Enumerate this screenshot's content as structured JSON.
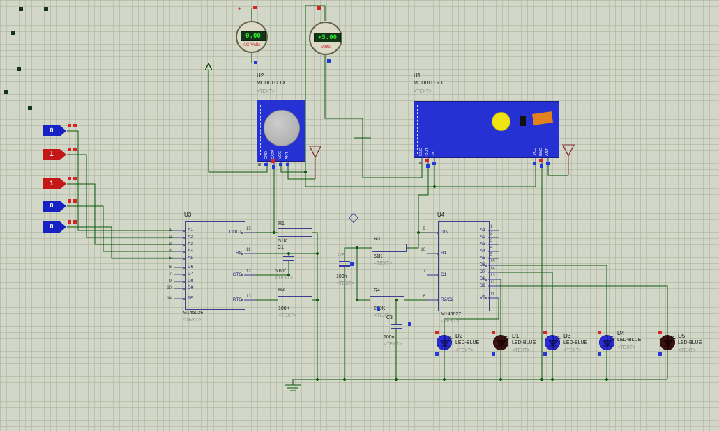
{
  "meters": {
    "ac": {
      "reading": "0.00",
      "label": "AC Volts",
      "plus": "+",
      "minus": "-"
    },
    "dc": {
      "reading": "+5.00",
      "label": "Volts"
    }
  },
  "modules": {
    "tx": {
      "ref": "U2",
      "name": "MODULO TX",
      "text": "<TEXT>",
      "pins": [
        "GND",
        "DATA",
        "VCC",
        "ANT"
      ]
    },
    "rx": {
      "ref": "U1",
      "name": "MODULO RX",
      "text": "<TEXT>",
      "left_pins": [
        "GND",
        "OUT",
        "VCC"
      ],
      "right_pins": [
        "VCC",
        "GND",
        "ANT"
      ]
    }
  },
  "logic_inputs": [
    {
      "value": "0",
      "state": "low"
    },
    {
      "value": "1",
      "state": "high"
    },
    {
      "value": "1",
      "state": "high"
    },
    {
      "value": "0",
      "state": "low"
    },
    {
      "value": "0",
      "state": "low"
    }
  ],
  "u3": {
    "ref": "U3",
    "part": "M145026",
    "text": "<TEXT>",
    "left_pins": [
      {
        "num": "1",
        "label": "A1"
      },
      {
        "num": "2",
        "label": "A2"
      },
      {
        "num": "3",
        "label": "A3"
      },
      {
        "num": "4",
        "label": "A4"
      },
      {
        "num": "5",
        "label": "A5"
      },
      {
        "num": "6",
        "label": "D6"
      },
      {
        "num": "7",
        "label": "D7"
      },
      {
        "num": "9",
        "label": "D8"
      },
      {
        "num": "10",
        "label": "D9"
      },
      {
        "num": "14",
        "label": "TE"
      }
    ],
    "right_pins": [
      {
        "num": "15",
        "label": "DOUT"
      },
      {
        "num": "11",
        "label": "RS"
      },
      {
        "num": "12",
        "label": "CTC"
      },
      {
        "num": "13",
        "label": "RTC"
      }
    ]
  },
  "u4": {
    "ref": "U4",
    "part": "M145027",
    "text": "<TEXT>",
    "left_pins": [
      {
        "num": "9",
        "label": "DIN"
      },
      {
        "num": "10",
        "label": "R1"
      },
      {
        "num": "7",
        "label": "C1"
      },
      {
        "num": "6",
        "label": "R2/C2"
      }
    ],
    "right_pins": [
      {
        "num": "1",
        "label": "A1"
      },
      {
        "num": "2",
        "label": "A2"
      },
      {
        "num": "3",
        "label": "A3"
      },
      {
        "num": "4",
        "label": "A4"
      },
      {
        "num": "5",
        "label": "A5"
      },
      {
        "num": "15",
        "label": "D6"
      },
      {
        "num": "14",
        "label": "D7"
      },
      {
        "num": "13",
        "label": "D8"
      },
      {
        "num": "12",
        "label": "D9"
      },
      {
        "num": "11",
        "label": "VT"
      }
    ]
  },
  "resistors": [
    {
      "ref": "R1",
      "value": "51K",
      "text": ""
    },
    {
      "ref": "R2",
      "value": "100K",
      "text": "<TEXT>"
    },
    {
      "ref": "R3",
      "value": "51K",
      "text": "<TEXT>"
    },
    {
      "ref": "R4",
      "value": "200K",
      "text": "<TEXT>"
    }
  ],
  "capacitors": [
    {
      "ref": "C1",
      "value": "5.6nf",
      "text": "<TEXT>"
    },
    {
      "ref": "C2",
      "value": "100n",
      "text": "<TEXT>"
    },
    {
      "ref": "C3",
      "value": "100n",
      "text": "<TEXT>"
    }
  ],
  "leds": [
    {
      "ref": "D2",
      "type": "LED-BLUE",
      "text": "<TEXT>",
      "state": "on"
    },
    {
      "ref": "D1",
      "type": "LED-BLUE",
      "text": "<TEXT>",
      "state": "off"
    },
    {
      "ref": "D3",
      "type": "LED-BLUE",
      "text": "<TEXT>",
      "state": "on"
    },
    {
      "ref": "D4",
      "type": "LED-BLUE",
      "text": "<TEXT>",
      "state": "on"
    },
    {
      "ref": "D5",
      "type": "LED-BLUE",
      "text": "<TEXT>",
      "state": "off"
    }
  ],
  "colors": {
    "wire": "#0b5a0b",
    "pin": "#3a3a9a",
    "module_body": "#2531d2",
    "logic_high": "#c41818",
    "logic_low": "#1722c4",
    "led_on": "#2b2bdc",
    "led_off": "#401112",
    "meter_text": "#2ee62e"
  }
}
